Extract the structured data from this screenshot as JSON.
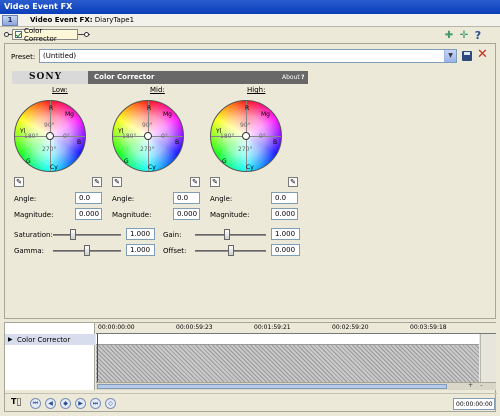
{
  "window": {
    "title": "Video Event FX"
  },
  "fx_bar": {
    "badge": "1",
    "title_bold": "Video Event FX:",
    "title_rest": " DiaryTape1"
  },
  "chain": {
    "plugin_label": "Color Corrector"
  },
  "preset": {
    "label": "Preset:",
    "value": "(Untitled)"
  },
  "plugin_header": {
    "logo": "SONY",
    "name": "Color Corrector",
    "about": "About",
    "help": "?"
  },
  "wheels": [
    {
      "label": "Low:",
      "angle": "0.0",
      "magnitude": "0.000"
    },
    {
      "label": "Mid:",
      "angle": "0.0",
      "magnitude": "0.000"
    },
    {
      "label": "High:",
      "angle": "0.0",
      "magnitude": "0.000"
    }
  ],
  "wheel_labels": {
    "deg90": "90°",
    "deg180": "180°",
    "deg0": "0°",
    "deg270": "270°",
    "r": "R",
    "mg": "Mg",
    "b": "B",
    "cy": "Cy",
    "g": "G",
    "yl": "Yl"
  },
  "fields": {
    "angle": "Angle:",
    "magnitude": "Magnitude:"
  },
  "sliders": [
    {
      "label": "Saturation:",
      "value": "1.000",
      "level": 0.3
    },
    {
      "label": "Gamma:",
      "value": "1.000",
      "level": 0.5
    },
    {
      "label": "Gain:",
      "value": "1.000",
      "level": 0.45
    },
    {
      "label": "Offset:",
      "value": "0.000",
      "level": 0.5
    }
  ],
  "timeline": {
    "track_label": "Color Corrector",
    "ruler": [
      "00:00:00:00",
      "00:00:59:23",
      "00:01:59:21",
      "00:02:59:20",
      "00:03:59:18"
    ],
    "zoom_plus": "+",
    "zoom_minus": "-",
    "time": "00:00:00:00"
  },
  "colors": {
    "title_bar": "#0a3fb8",
    "panel_header": "#686868"
  }
}
